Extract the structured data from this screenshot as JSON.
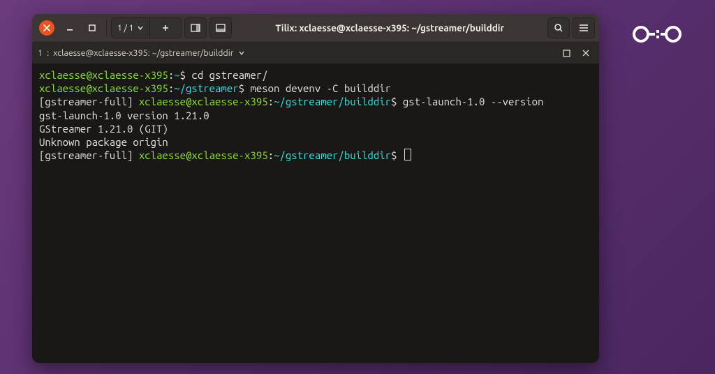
{
  "window": {
    "title": "Tilix: xclaesse@xclaesse-x395: ~/gstreamer/builddir",
    "session_counter": "1 / 1"
  },
  "tab": {
    "index": "1",
    "title": "xclaesse@xclaesse-x395: ~/gstreamer/builddir"
  },
  "icons": {
    "close": "close-icon",
    "minimize": "minimize-icon",
    "maximize": "maximize-icon",
    "dropdown": "chevron-down-icon",
    "add": "plus-icon",
    "split_right": "split-right-icon",
    "split_down": "split-down-icon",
    "search": "search-icon",
    "menu": "hamburger-icon",
    "tab_max": "tab-maximize-icon",
    "tab_close": "tab-close-icon"
  },
  "terminal": {
    "lines": [
      {
        "segments": [
          {
            "cls": "c-green",
            "text": "xclaesse@xclaesse-x395"
          },
          {
            "cls": "c-white",
            "text": ":"
          },
          {
            "cls": "c-cyan",
            "text": "~"
          },
          {
            "cls": "c-white",
            "text": "$ cd gstreamer/"
          }
        ]
      },
      {
        "segments": [
          {
            "cls": "c-green",
            "text": "xclaesse@xclaesse-x395"
          },
          {
            "cls": "c-white",
            "text": ":"
          },
          {
            "cls": "c-cyan",
            "text": "~/gstreamer"
          },
          {
            "cls": "c-white",
            "text": "$ meson devenv -C builddir"
          }
        ]
      },
      {
        "segments": [
          {
            "cls": "c-ctx",
            "text": "[gstreamer-full] "
          },
          {
            "cls": "c-green",
            "text": "xclaesse@xclaesse-x395"
          },
          {
            "cls": "c-white",
            "text": ":"
          },
          {
            "cls": "c-cyan",
            "text": "~/gstreamer/builddir"
          },
          {
            "cls": "c-white",
            "text": "$ gst-launch-1.0 --version"
          }
        ]
      },
      {
        "segments": [
          {
            "cls": "c-white",
            "text": "gst-launch-1.0 version 1.21.0"
          }
        ]
      },
      {
        "segments": [
          {
            "cls": "c-white",
            "text": "GStreamer 1.21.0 (GIT)"
          }
        ]
      },
      {
        "segments": [
          {
            "cls": "c-white",
            "text": "Unknown package origin"
          }
        ]
      },
      {
        "segments": [
          {
            "cls": "c-ctx",
            "text": "[gstreamer-full] "
          },
          {
            "cls": "c-green",
            "text": "xclaesse@xclaesse-x395"
          },
          {
            "cls": "c-white",
            "text": ":"
          },
          {
            "cls": "c-cyan",
            "text": "~/gstreamer/builddir"
          },
          {
            "cls": "c-white",
            "text": "$ "
          }
        ],
        "cursor": true
      }
    ]
  }
}
